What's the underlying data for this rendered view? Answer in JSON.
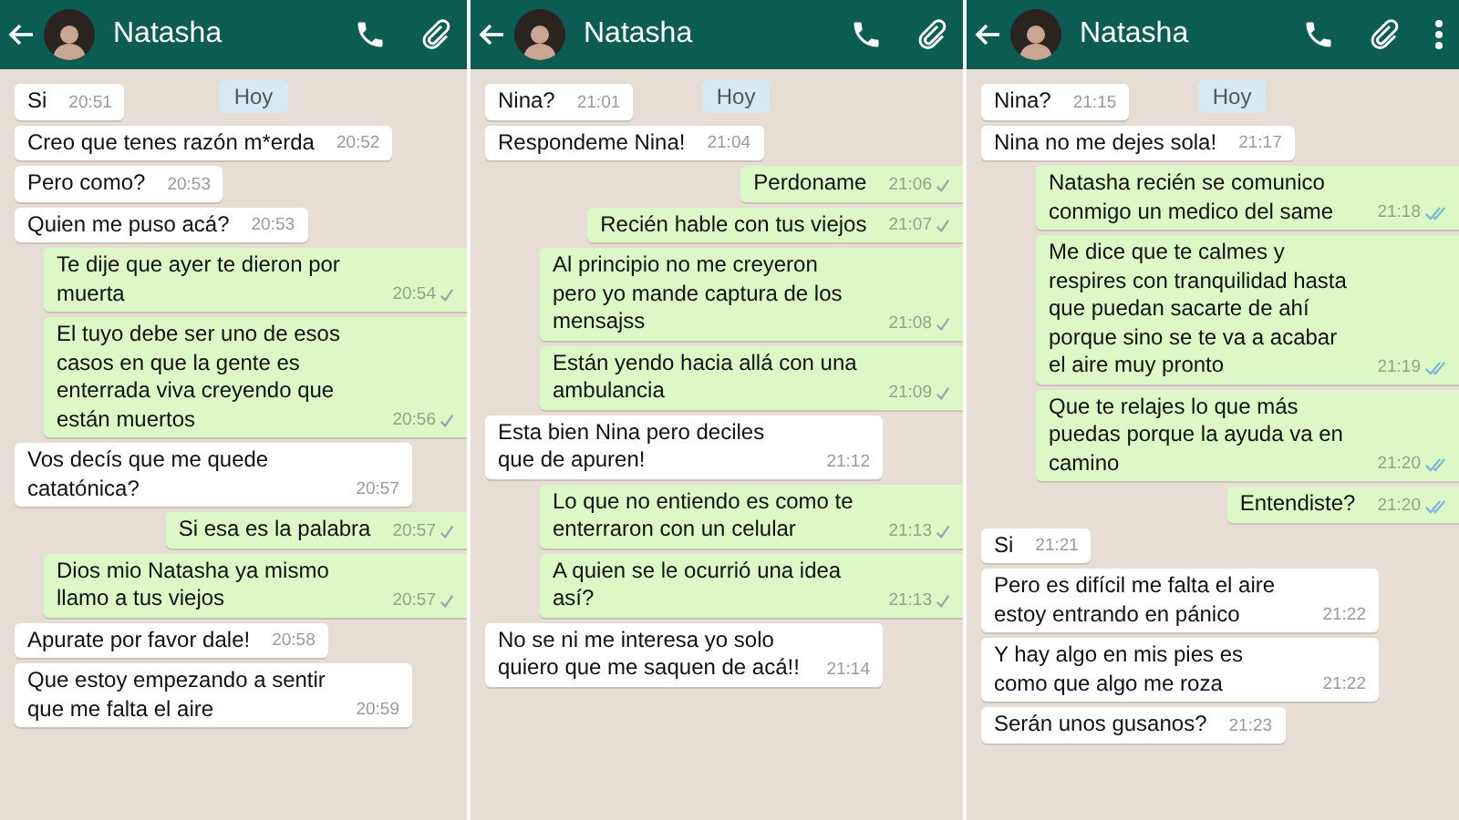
{
  "panels": [
    {
      "contact": {
        "name": "Natasha"
      },
      "menu_icon": false,
      "date_chip": "Hoy",
      "messages": [
        {
          "kind": "in",
          "text": "Si",
          "time": "20:51"
        },
        {
          "kind": "in",
          "text": "Creo que tenes razón m*erda",
          "time": "20:52"
        },
        {
          "kind": "in",
          "text": "Pero como?",
          "time": "20:53"
        },
        {
          "kind": "in",
          "text": "Quien me puso acá?",
          "time": "20:53"
        },
        {
          "kind": "out",
          "text": "Te dije que ayer te dieron por muerta",
          "time": "20:54",
          "read": false
        },
        {
          "kind": "out",
          "text": "El tuyo debe ser uno de esos casos en que la gente es enterrada viva creyendo que están muertos",
          "time": "20:56",
          "read": false
        },
        {
          "kind": "in",
          "text": "Vos decís que me quede catatónica?",
          "time": "20:57"
        },
        {
          "kind": "out",
          "text": "Si esa es la palabra",
          "time": "20:57",
          "read": false
        },
        {
          "kind": "out",
          "text": "Dios mio Natasha ya mismo llamo a tus viejos",
          "time": "20:57",
          "read": false
        },
        {
          "kind": "in",
          "text": "Apurate por favor dale!",
          "time": "20:58"
        },
        {
          "kind": "in",
          "text": "Que estoy empezando a sentir que me falta el aire",
          "time": "20:59"
        }
      ]
    },
    {
      "contact": {
        "name": "Natasha"
      },
      "menu_icon": false,
      "date_chip": "Hoy",
      "messages": [
        {
          "kind": "in",
          "text": "Nina?",
          "time": "21:01"
        },
        {
          "kind": "in",
          "text": "Respondeme Nina!",
          "time": "21:04"
        },
        {
          "kind": "out",
          "text": "Perdoname",
          "time": "21:06",
          "read": false
        },
        {
          "kind": "out",
          "text": "Recién hable con tus viejos",
          "time": "21:07",
          "read": false
        },
        {
          "kind": "out",
          "text": "Al principio no me creyeron pero yo mande captura de los mensajss",
          "time": "21:08",
          "read": false
        },
        {
          "kind": "out",
          "text": "Están yendo hacia allá con una ambulancia",
          "time": "21:09",
          "read": false
        },
        {
          "kind": "in",
          "text": "Esta bien Nina pero deciles que de apuren!",
          "time": "21:12"
        },
        {
          "kind": "out",
          "text": "Lo que no entiendo es como te enterraron con un celular",
          "time": "21:13",
          "read": false
        },
        {
          "kind": "out",
          "text": "A quien se le ocurrió una idea así?",
          "time": "21:13",
          "read": false
        },
        {
          "kind": "in",
          "text": "No se ni me interesa yo solo quiero que me saquen de acá!!",
          "time": "21:14"
        }
      ]
    },
    {
      "contact": {
        "name": "Natasha"
      },
      "menu_icon": true,
      "date_chip": "Hoy",
      "messages": [
        {
          "kind": "in",
          "text": "Nina?",
          "time": "21:15"
        },
        {
          "kind": "in",
          "text": "Nina no me dejes sola!",
          "time": "21:17"
        },
        {
          "kind": "out",
          "text": "Natasha recién se comunico conmigo un medico del same",
          "time": "21:18",
          "read": true
        },
        {
          "kind": "out",
          "text": "Me dice que te calmes y respires con tranquilidad hasta que puedan sacarte de ahí porque sino se te va a acabar el aire muy pronto",
          "time": "21:19",
          "read": true
        },
        {
          "kind": "out",
          "text": "Que te relajes lo que más puedas porque la ayuda va en camino",
          "time": "21:20",
          "read": true
        },
        {
          "kind": "out",
          "text": "Entendiste?",
          "time": "21:20",
          "read": true
        },
        {
          "kind": "in",
          "text": "Si",
          "time": "21:21"
        },
        {
          "kind": "in",
          "text": "Pero es difícil me falta el aire estoy entrando en pánico",
          "time": "21:22"
        },
        {
          "kind": "in",
          "text": "Y hay algo en mis pies es como que algo me roza",
          "time": "21:22"
        },
        {
          "kind": "in",
          "text": "Serán unos gusanos?",
          "time": "21:23"
        }
      ]
    }
  ]
}
